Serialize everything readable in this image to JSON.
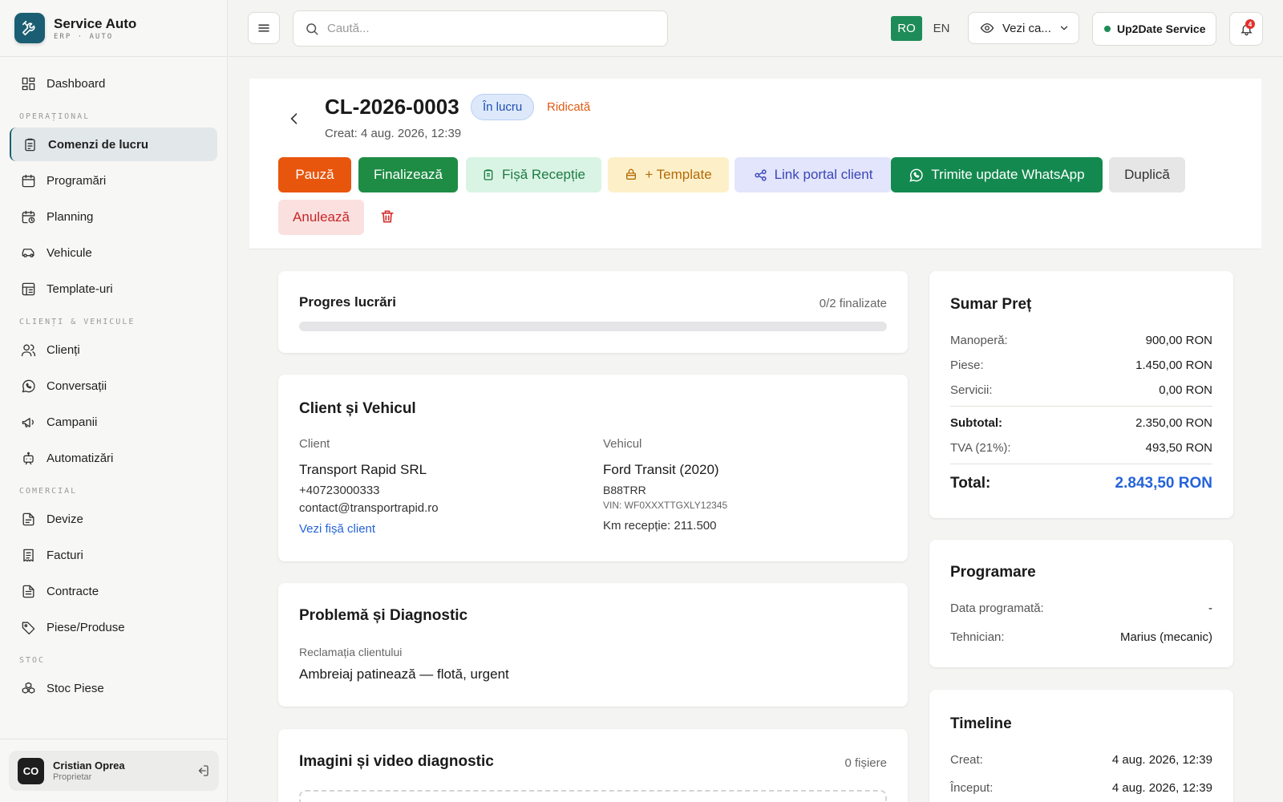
{
  "brand": {
    "title": "Service Auto",
    "subtitle": "ERP · AUTO"
  },
  "nav": {
    "dashboard": "Dashboard",
    "section_operational": "OPERAȚIONAL",
    "work_orders": "Comenzi de lucru",
    "appointments": "Programări",
    "planning": "Planning",
    "vehicles": "Vehicule",
    "templates": "Template-uri",
    "section_clients": "CLIENȚI & VEHICULE",
    "clients": "Clienți",
    "conversations": "Conversații",
    "campaigns": "Campanii",
    "automations": "Automatizări",
    "section_commercial": "COMERCIAL",
    "quotes": "Devize",
    "invoices": "Facturi",
    "contracts": "Contracte",
    "parts": "Piese/Produse",
    "section_stock": "STOC",
    "stock_parts": "Stoc Piese"
  },
  "user": {
    "initials": "CO",
    "name": "Cristian Oprea",
    "role": "Proprietar"
  },
  "topbar": {
    "search_placeholder": "Caută...",
    "lang_ro": "RO",
    "lang_en": "EN",
    "view_label": "Vezi ca...",
    "service_name": "Up2Date Service",
    "notifications_count": "4"
  },
  "work_order": {
    "id": "CL-2026-0003",
    "status": "În lucru",
    "priority": "Ridicată",
    "created": "Creat: 4 aug. 2026, 12:39"
  },
  "actions": {
    "pause": "Pauză",
    "finalize": "Finalizează",
    "reception_sheet": "Fișă Recepție",
    "template": "+ Template",
    "portal_link": "Link portal client",
    "whatsapp": "Trimite update WhatsApp",
    "duplicate": "Duplică",
    "cancel": "Anulează"
  },
  "progress": {
    "title": "Progres lucrări",
    "count": "0/2 finalizate",
    "fraction": 0
  },
  "client_vehicle": {
    "title": "Client și Vehicul",
    "client_label": "Client",
    "client_name": "Transport Rapid SRL",
    "client_phone": "+40723000333",
    "client_email": "contact@transportrapid.ro",
    "client_link": "Vezi fișă client",
    "vehicle_label": "Vehicul",
    "vehicle_name": "Ford Transit (2020)",
    "vehicle_plate": "B88TRR",
    "vehicle_vin": "VIN: WF0XXXTTGXLY12345",
    "vehicle_km": "Km recepție: 211.500"
  },
  "diagnosis": {
    "title": "Problemă și Diagnostic",
    "complaint_label": "Reclamația clientului",
    "complaint": "Ambreiaj patinează — flotă, urgent"
  },
  "media": {
    "title": "Imagini și video diagnostic",
    "count": "0 fișiere"
  },
  "price": {
    "title": "Sumar Preț",
    "labor_label": "Manoperă:",
    "labor": "900,00 RON",
    "parts_label": "Piese:",
    "parts": "1.450,00 RON",
    "services_label": "Servicii:",
    "services": "0,00 RON",
    "subtotal_label": "Subtotal:",
    "subtotal": "2.350,00 RON",
    "vat_label": "TVA (21%):",
    "vat": "493,50 RON",
    "total_label": "Total:",
    "total": "2.843,50 RON"
  },
  "schedule": {
    "title": "Programare",
    "date_label": "Data programată:",
    "date": "-",
    "tech_label": "Tehnician:",
    "tech": "Marius (mecanic)"
  },
  "timeline": {
    "title": "Timeline",
    "created_label": "Creat:",
    "created": "4 aug. 2026, 12:39",
    "started_label": "Început:",
    "started": "4 aug. 2026, 12:39"
  },
  "colors": {
    "accent": "#1b5e73",
    "green": "#1e8c58",
    "orange": "#e8560e",
    "blue": "#2563d9"
  },
  "icons": [
    "tools-icon",
    "menu-icon",
    "search-icon",
    "eye-icon",
    "chevron-down-icon",
    "bell-icon",
    "logout-icon",
    "chevron-left-icon",
    "trash-icon",
    "clipboard-icon",
    "bag-icon",
    "share-icon",
    "whatsapp-icon"
  ]
}
